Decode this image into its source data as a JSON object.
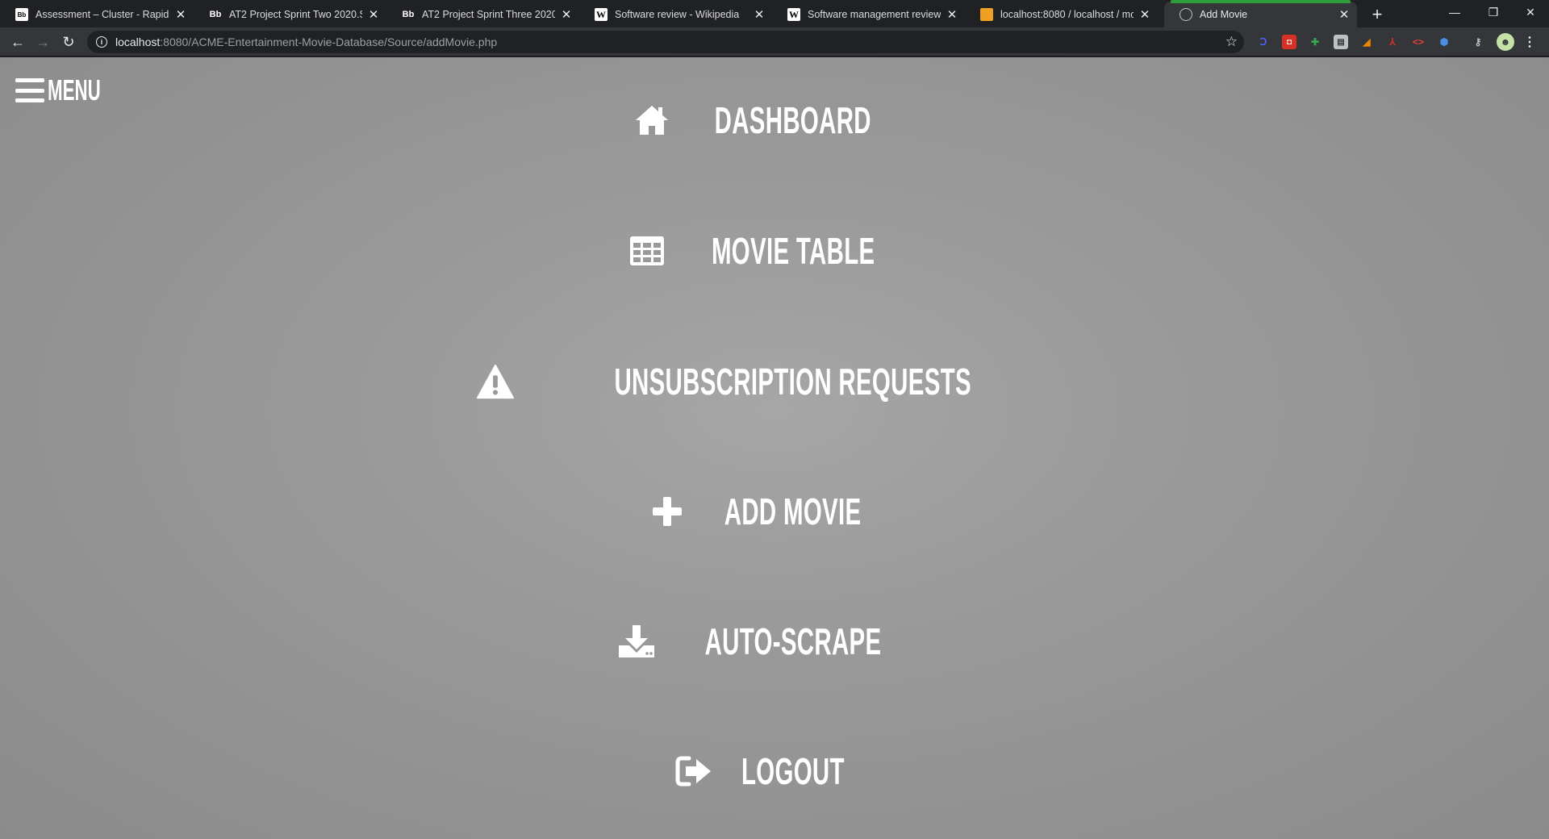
{
  "browser": {
    "tabs": [
      {
        "title": "Assessment – Cluster - Rapid Ap",
        "icon": "blackboard-icon"
      },
      {
        "title": "AT2 Project Sprint Two 2020.S1.v",
        "icon": "blackboard-icon"
      },
      {
        "title": "AT2 Project Sprint Three 2020.S1",
        "icon": "blackboard-icon"
      },
      {
        "title": "Software review - Wikipedia",
        "icon": "wikipedia-icon"
      },
      {
        "title": "Software management review - V",
        "icon": "wikipedia-icon"
      },
      {
        "title": "localhost:8080 / localhost / movi",
        "icon": "phpmyadmin-icon"
      },
      {
        "title": "Add Movie",
        "icon": "globe-icon",
        "active": true
      }
    ],
    "url_host": "localhost",
    "url_rest": ":8080/ACME-Entertainment-Movie-Database/Source/addMovie.php",
    "accent_color": "#2e9e3b"
  },
  "page": {
    "menu_label": "MENU",
    "nav_items": [
      {
        "label": "DASHBOARD",
        "icon": "home-icon"
      },
      {
        "label": "MOVIE TABLE",
        "icon": "table-icon"
      },
      {
        "label": "UNSUBSCRIPTION REQUESTS",
        "icon": "warning-icon"
      },
      {
        "label": "ADD MOVIE",
        "icon": "plus-icon"
      },
      {
        "label": "AUTO-SCRAPE",
        "icon": "download-icon"
      },
      {
        "label": "LOGOUT",
        "icon": "sign-out-icon"
      }
    ]
  }
}
